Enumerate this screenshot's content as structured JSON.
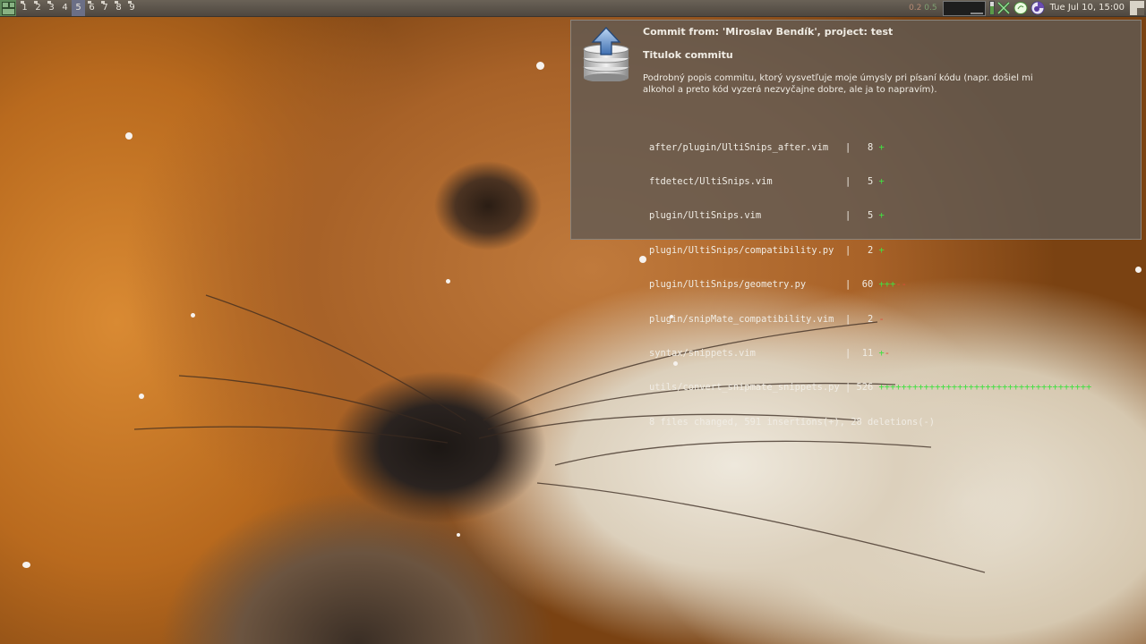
{
  "panel": {
    "workspaces": [
      {
        "label": "1",
        "active": false
      },
      {
        "label": "2",
        "active": false
      },
      {
        "label": "3",
        "active": false
      },
      {
        "label": "4",
        "active": false
      },
      {
        "label": "5",
        "active": true
      },
      {
        "label": "6",
        "active": false
      },
      {
        "label": "7",
        "active": false
      },
      {
        "label": "8",
        "active": false
      },
      {
        "label": "9",
        "active": false
      }
    ],
    "cpu_load_1": "0.2",
    "cpu_load_2": "0.5",
    "tray_icons": [
      "battery-icon",
      "network-tools-icon",
      "notes-icon",
      "pidgin-icon"
    ],
    "clock": "Tue Jul 10, 15:00",
    "colors": {
      "active_workspace": "#6b6f86",
      "panel_bg": "#5a534a"
    }
  },
  "notification": {
    "icon": "git-upload-database-icon",
    "title": "Commit from: 'Miroslav Bendík', project: test",
    "subject": "Titulok commitu",
    "description": "Podrobný popis commitu, ktorý vysvetľuje moje úmysly pri písaní kódu (napr. došiel mi alkohol a preto kód vyzerá nezvyčajne dobre, ale ja to napravím).",
    "stats": [
      {
        "file": "after/plugin/UltiSnips_after.vim  ",
        "count": "  8",
        "plus": "+",
        "minus": ""
      },
      {
        "file": "ftdetect/UltiSnips.vim            ",
        "count": "  5",
        "plus": "+",
        "minus": ""
      },
      {
        "file": "plugin/UltiSnips.vim              ",
        "count": "  5",
        "plus": "+",
        "minus": ""
      },
      {
        "file": "plugin/UltiSnips/compatibility.py ",
        "count": "  2",
        "plus": "+",
        "minus": ""
      },
      {
        "file": "plugin/UltiSnips/geometry.py      ",
        "count": " 60",
        "plus": "+++",
        "minus": "--"
      },
      {
        "file": "plugin/snipMate_compatibility.vim ",
        "count": "  2",
        "plus": "",
        "minus": "-"
      },
      {
        "file": "syntax/snippets.vim               ",
        "count": " 11",
        "plus": "+",
        "minus": "-"
      },
      {
        "file": "utils/convert_snipmate_snippets.py",
        "count": "526",
        "plus": "++++++++++++++++++++++++++++++++++++++",
        "minus": ""
      }
    ],
    "summary": "8 files changed, 591 insertions(+), 28 deletions(-)"
  }
}
